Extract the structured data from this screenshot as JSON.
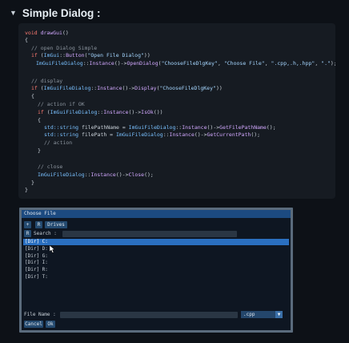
{
  "section": {
    "title": "Simple Dialog :",
    "caret": "▼"
  },
  "code": {
    "l1": {
      "type": "void",
      "name": "drawGui",
      "paren": "()"
    },
    "l2": "{",
    "l3": "// open Dialog Simple",
    "l4": {
      "kw": "if",
      "a": " (",
      "ns": "ImGui",
      "sep": "::",
      "fn": "Button",
      "b": "(",
      "str": "\"Open File Dialog\"",
      "c": "))"
    },
    "l5": {
      "cls": "ImGuiFileDialog",
      "a": "::",
      "inst": "Instance",
      "b": "()->",
      "fn": "OpenDialog",
      "c": "(",
      "s1": "\"ChooseFileDlgKey\"",
      "d": ", ",
      "s2": "\"Choose File\"",
      "e": ", ",
      "s3": "\".cpp,.h,.hpp\"",
      "f": ", ",
      "s4": "\".\"",
      "g": ");"
    },
    "l6": "// display",
    "l7": {
      "kw": "if",
      "a": " (",
      "cls": "ImGuiFileDialog",
      "b": "::",
      "inst": "Instance",
      "c": "()->",
      "fn": "Display",
      "d": "(",
      "str": "\"ChooseFileDlgKey\"",
      "e": "))"
    },
    "l8": "{",
    "l9": "// action if OK",
    "l10": {
      "kw": "if",
      "a": " (",
      "cls": "ImGuiFileDialog",
      "b": "::",
      "inst": "Instance",
      "c": "()->",
      "fn": "IsOk",
      "d": "())"
    },
    "l11": "{",
    "l12": {
      "type": "std::string",
      "var": " filePathName = ",
      "cls": "ImGuiFileDialog",
      "b": "::",
      "inst": "Instance",
      "c": "()->",
      "fn": "GetFilePathName",
      "d": "();"
    },
    "l13": {
      "type": "std::string",
      "var": " filePath = ",
      "cls": "ImGuiFileDialog",
      "b": "::",
      "inst": "Instance",
      "c": "()->",
      "fn": "GetCurrentPath",
      "d": "();"
    },
    "l14": "// action",
    "l15": "}",
    "l16": "// close",
    "l17": {
      "cls": "ImGuiFileDialog",
      "a": "::",
      "inst": "Instance",
      "b": "()->",
      "fn": "Close",
      "c": "();"
    },
    "l18": "}",
    "l19": "}"
  },
  "dialog": {
    "title": "Choose File",
    "toolbar": {
      "add_label": "+",
      "reset_label": "R",
      "drives_label": "Drives"
    },
    "search": {
      "clear_label": "R",
      "label": "Search :",
      "value": ""
    },
    "rows": [
      "[Dir] C:",
      "[Dir] D:",
      "[Dir] G:",
      "[Dir] I:",
      "[Dir] R:",
      "[Dir] T:"
    ],
    "selected_row": "[Dir] C:",
    "filename": {
      "label": "File Name :",
      "value": ""
    },
    "filter": {
      "selected": ".cpp",
      "arrow": "▼"
    },
    "buttons": {
      "cancel": "Cancel",
      "ok": "Ok"
    }
  },
  "colors": {
    "background": "#0d1117",
    "code_bg": "#161b22",
    "keyword": "#ff7b72",
    "function": "#d2a8ff",
    "type": "#79c0ff",
    "string": "#a5d6ff",
    "comment": "#8b949e",
    "dialog_title": "#1c4a80",
    "selection": "#2a6fc0"
  },
  "icons": {
    "section_caret": "caret-down-icon",
    "mouse": "mouse-pointer-icon",
    "combo_arrow": "chevron-down-icon"
  }
}
